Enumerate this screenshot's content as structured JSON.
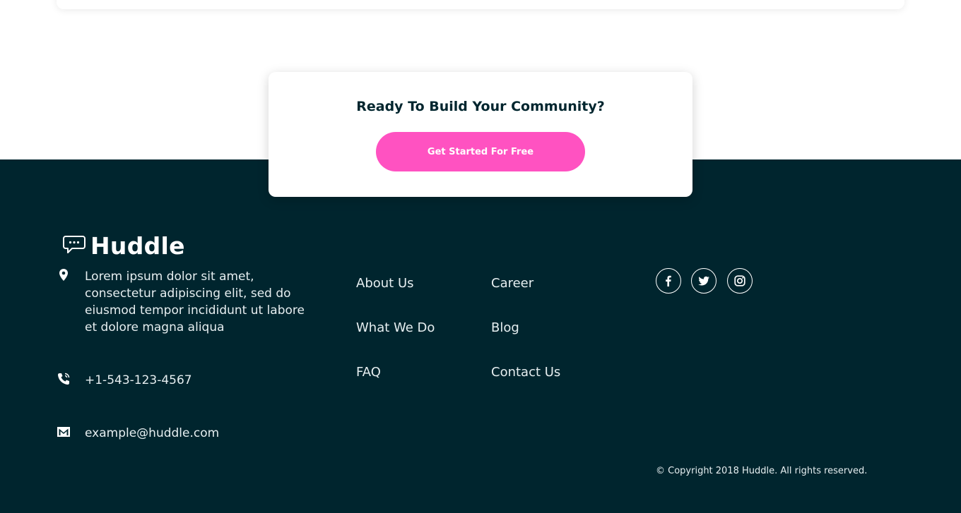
{
  "cta": {
    "title": "Ready To Build Your Community?",
    "button_label": "Get Started For Free"
  },
  "brand": {
    "name": "Huddle"
  },
  "contact": {
    "address": "Lorem ipsum dolor sit amet, consectetur adipiscing elit, sed do eiusmod tempor incididunt ut labore et dolore magna aliqua",
    "phone": "+1-543-123-4567",
    "email": "example@huddle.com"
  },
  "links": {
    "col1": [
      "About Us",
      "What We Do",
      "FAQ"
    ],
    "col2": [
      "Career",
      "Blog",
      "Contact Us"
    ]
  },
  "social": [
    "facebook-icon",
    "twitter-icon",
    "instagram-icon"
  ],
  "copyright": "© Copyright 2018 Huddle. All rights reserved.",
  "colors": {
    "footer_bg": "#00252e",
    "accent": "#ff52c1",
    "text_light": "#e6eef0"
  }
}
